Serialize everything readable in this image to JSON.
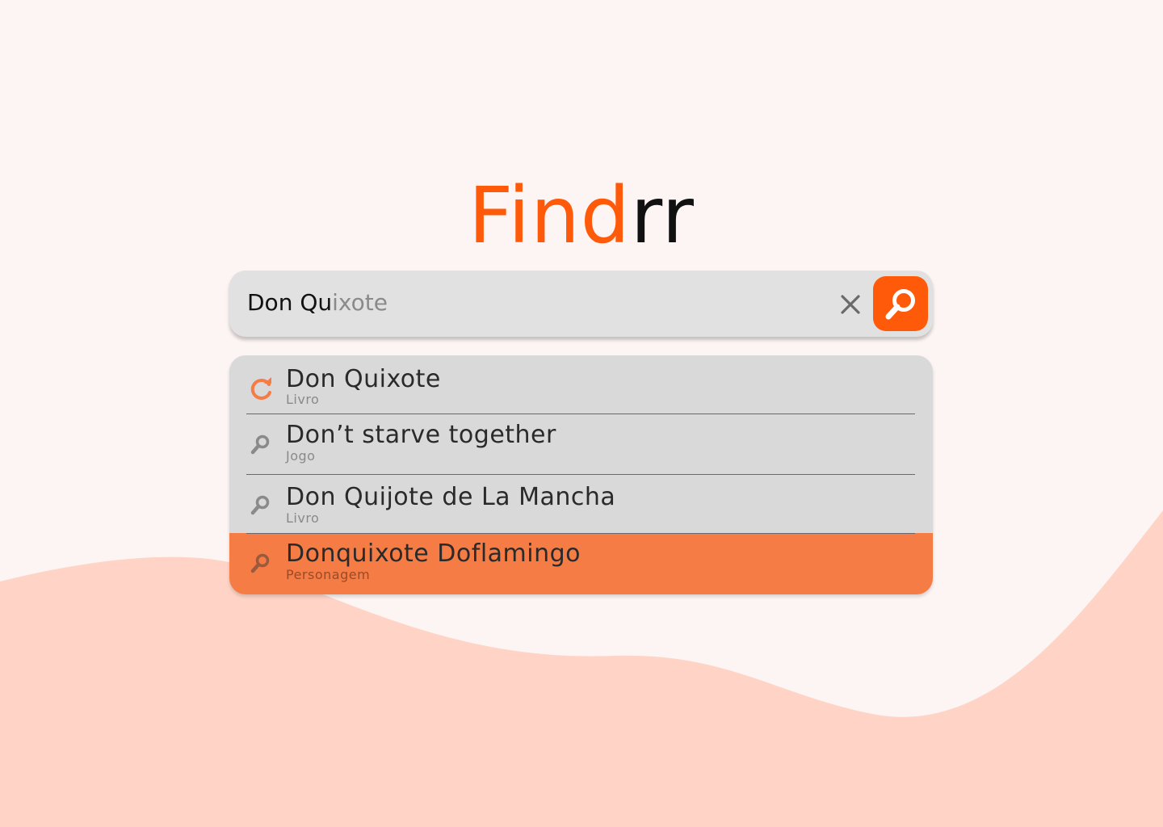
{
  "logo": {
    "part_a": "Find",
    "part_b": "rr"
  },
  "search": {
    "typed": "Don Qu",
    "suggestion": "ixote"
  },
  "colors": {
    "accent": "#ff5a0a",
    "background": "#fdf5f3",
    "wave": "#ffd4c6",
    "active_row": "#f57c45"
  },
  "results": [
    {
      "title": "Don Quixote",
      "category": "Livro",
      "icon": "history-icon"
    },
    {
      "title": "Don’t starve together",
      "category": "Jogo",
      "icon": "search-icon"
    },
    {
      "title": "Don Quijote de La Mancha",
      "category": "Livro",
      "icon": "search-icon"
    },
    {
      "title": "Donquixote Doflamingo",
      "category": "Personagem",
      "icon": "search-icon",
      "highlighted": true
    }
  ]
}
